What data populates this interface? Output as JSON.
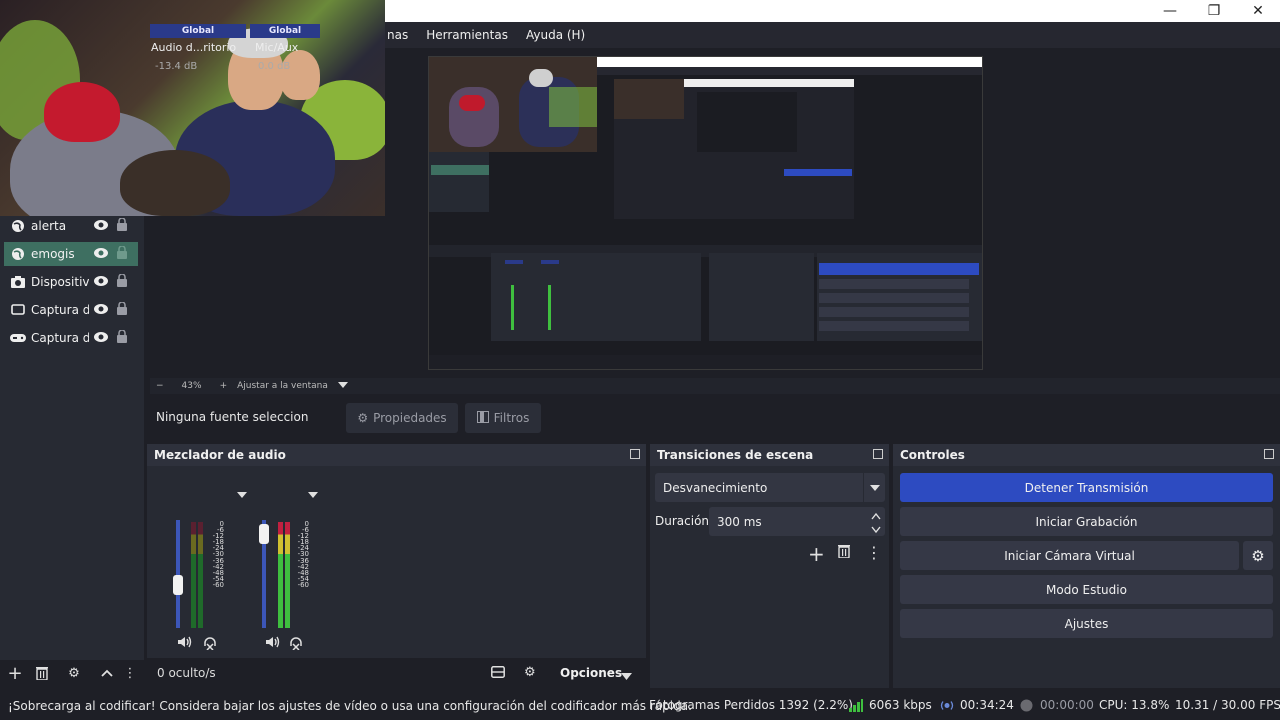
{
  "menu": [
    "nas",
    "Herramientas",
    "Ayuda (H)"
  ],
  "window_controls": {
    "minimize": "—",
    "maximize": "❐",
    "close": "✕"
  },
  "sources": [
    {
      "label": "alerta",
      "icon": "globe-icon",
      "selected": false
    },
    {
      "label": "emogis",
      "icon": "globe-icon",
      "selected": true
    },
    {
      "label": "Dispositiv",
      "icon": "camera-icon",
      "selected": false
    },
    {
      "label": "Captura d",
      "icon": "monitor-icon",
      "selected": false
    },
    {
      "label": "Captura d",
      "icon": "gamepad-icon",
      "selected": false
    }
  ],
  "zoom": {
    "minus": "−",
    "value": "43%",
    "plus": "+",
    "fit_label": "Ajustar a la ventana"
  },
  "properties_bar": {
    "no_source": "Ninguna fuente seleccionada",
    "properties": "Propiedades",
    "filters": "Filtros"
  },
  "mixer": {
    "title": "Mezclador de audio",
    "channels": [
      {
        "header": "Global",
        "name": "Audio d...ritorio",
        "db": "-13.4 dB",
        "volume": 0.37
      },
      {
        "header": "Global",
        "name": "Mic/Aux",
        "db": "0.0 dB",
        "volume": 0.95
      }
    ],
    "scale": [
      "0",
      "-6",
      "-12",
      "-18",
      "-24",
      "-30",
      "-36",
      "-42",
      "-48",
      "-54",
      "-60"
    ],
    "hidden_label": "0 oculto/s",
    "options_label": "Opciones"
  },
  "transitions": {
    "title": "Transiciones de escena",
    "selected": "Desvanecimiento",
    "duration_label": "Duración",
    "duration_value": "300 ms"
  },
  "controls": {
    "title": "Controles",
    "stop_stream": "Detener Transmisión",
    "start_recording": "Iniciar Grabación",
    "start_virtual_cam": "Iniciar Cámara Virtual",
    "studio_mode": "Modo Estudio",
    "settings": "Ajustes"
  },
  "status": {
    "warning": "¡Sobrecarga al codificar! Considera bajar los ajustes de vídeo o usa una configuración del codificador más rápida.",
    "dropped": "Fotogramas Perdidos 1392 (2.2%)",
    "bitrate": "6063 kbps",
    "stream_time": "00:34:24",
    "rec_time": "00:00:00",
    "cpu": "CPU: 13.8%",
    "fps": "10.31 / 30.00 FPS"
  },
  "colors": {
    "accent": "#2d4bc1",
    "selected_source": "#3e6f61",
    "bitrate_green": "#3fbf3f"
  }
}
